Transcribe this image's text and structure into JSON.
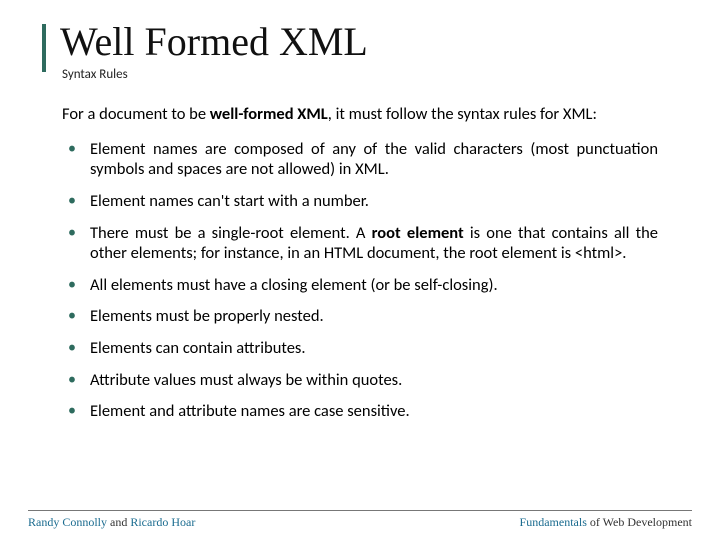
{
  "title": "Well Formed XML",
  "subtitle": "Syntax Rules",
  "intro": {
    "pre": "For a document to be ",
    "bold": "well-formed XML",
    "post": ", it must follow the syntax rules for XML:"
  },
  "rules": [
    {
      "text": "Element names are composed of any of the valid characters (most punctuation symbols and spaces are not allowed) in XML."
    },
    {
      "text": "Element names can't start with a number."
    },
    {
      "pre": "There must be a single-root element. A ",
      "bold": "root element",
      "post": " is one that contains all the other elements; for instance, in an HTML document, the root element is <html>."
    },
    {
      "text": "All elements must have a closing element (or be self-closing)."
    },
    {
      "text": "Elements must be properly nested."
    },
    {
      "text": "Elements can contain attributes."
    },
    {
      "text": "Attribute values must always be within quotes."
    },
    {
      "text": "Element and attribute names are case sensitive."
    }
  ],
  "footer": {
    "author1": "Randy Connolly",
    "and": " and ",
    "author2": "Ricardo Hoar",
    "right_pre": "Fundamentals",
    "right_post": " of Web Development"
  }
}
